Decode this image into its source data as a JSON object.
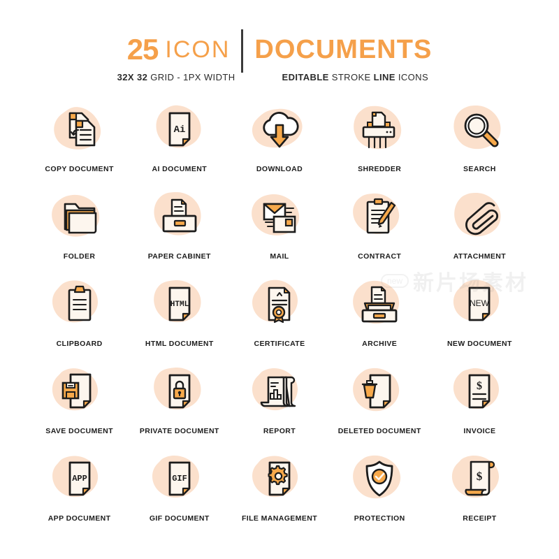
{
  "header": {
    "count": "25",
    "word_icon": "ICON",
    "category": "DOCUMENTS",
    "sub_left_bold": "32X 32",
    "sub_left_normal": "GRID - 1PX WIDTH",
    "sub_right_bold_1": "EDITABLE",
    "sub_right_normal_1": "STROKE",
    "sub_right_bold_2": "LINE",
    "sub_right_normal_2": "ICONS"
  },
  "palette": {
    "orange_brand": "#F5A04A",
    "orange_accent": "#F7A94B",
    "blob_peach": "#FBE0CC",
    "paper_cream": "#FDF6EE",
    "ink": "#1c1c1c",
    "white": "#ffffff"
  },
  "watermark": {
    "badge": "new",
    "text": "新片场素材"
  },
  "icons": [
    {
      "label": "COPY DOCUMENT",
      "name": "copy-document"
    },
    {
      "label": "AI DOCUMENT",
      "name": "ai-document",
      "doc_text": "Ai"
    },
    {
      "label": "DOWNLOAD",
      "name": "download"
    },
    {
      "label": "SHREDDER",
      "name": "shredder"
    },
    {
      "label": "SEARCH",
      "name": "search"
    },
    {
      "label": "FOLDER",
      "name": "folder"
    },
    {
      "label": "PAPER CABINET",
      "name": "paper-cabinet"
    },
    {
      "label": "MAIL",
      "name": "mail"
    },
    {
      "label": "CONTRACT",
      "name": "contract"
    },
    {
      "label": "ATTACHMENT",
      "name": "attachment"
    },
    {
      "label": "CLIPBOARD",
      "name": "clipboard"
    },
    {
      "label": "HTML DOCUMENT",
      "name": "html-document",
      "doc_text": "HTML"
    },
    {
      "label": "CERTIFICATE",
      "name": "certificate"
    },
    {
      "label": "ARCHIVE",
      "name": "archive"
    },
    {
      "label": "NEW DOCUMENT",
      "name": "new-document",
      "doc_text": "NEW"
    },
    {
      "label": "SAVE DOCUMENT",
      "name": "save-document"
    },
    {
      "label": "PRIVATE DOCUMENT",
      "name": "private-document"
    },
    {
      "label": "REPORT",
      "name": "report"
    },
    {
      "label": "DELETED DOCUMENT",
      "name": "deleted-document"
    },
    {
      "label": "INVOICE",
      "name": "invoice",
      "doc_text": "$"
    },
    {
      "label": "APP DOCUMENT",
      "name": "app-document",
      "doc_text": "APP"
    },
    {
      "label": "GIF DOCUMENT",
      "name": "gif-document",
      "doc_text": "GIF"
    },
    {
      "label": "FILE MANAGEMENT",
      "name": "file-management"
    },
    {
      "label": "PROTECTION",
      "name": "protection"
    },
    {
      "label": "RECEIPT",
      "name": "receipt",
      "doc_text": "$"
    }
  ]
}
